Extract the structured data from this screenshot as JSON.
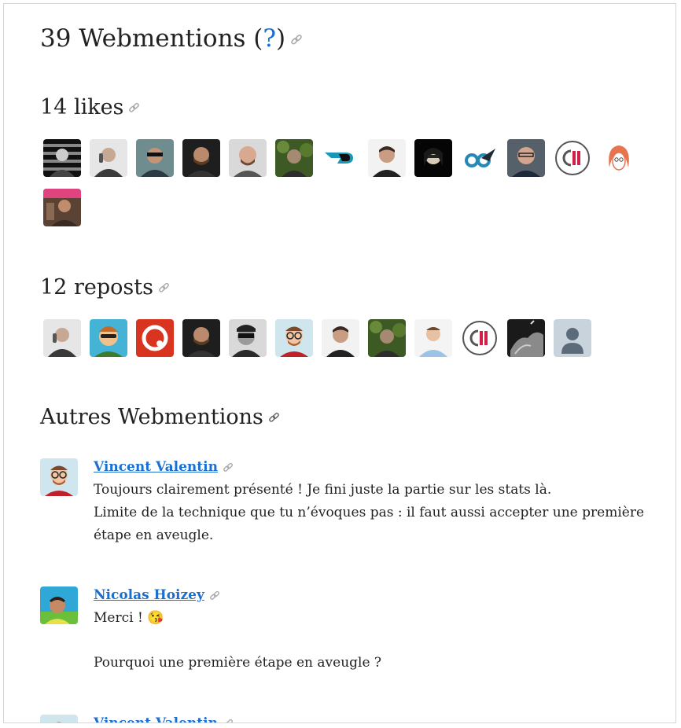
{
  "header": {
    "title_prefix": "39 Webmentions (",
    "help_glyph": "?",
    "title_suffix": ")"
  },
  "likes": {
    "heading": "14 likes",
    "faces": [
      "bw-stripes",
      "man-phone",
      "man-sunglasses",
      "man-beard-dark",
      "man-bald",
      "man-forest",
      "logo-blue-shape",
      "man-portrait",
      "woman-dark",
      "logo-blue-rocket",
      "man-glasses",
      "logo-c11",
      "drawing-redhead",
      "man-pink"
    ]
  },
  "reposts": {
    "heading": "12 reposts",
    "faces": [
      "man-phone",
      "cartoon-avatar",
      "logo-red",
      "man-beard-dark",
      "man-sunglasses-bw",
      "cartoon-vincent",
      "man-portrait",
      "man-forest",
      "man-shirt",
      "logo-c11",
      "hands-bw",
      "default-avatar"
    ]
  },
  "others": {
    "heading": "Autres Webmentions",
    "mentions": [
      {
        "author": "Vincent Valentin",
        "lines": [
          "Toujours clairement présenté ! Je fini juste la partie sur les stats là.",
          "Limite de la technique que tu n’évoques pas : il faut aussi accepter une première étape en aveugle."
        ]
      },
      {
        "author": "Nicolas Hoizey",
        "line1": "Merci ! 😘",
        "line2": "Pourquoi une première étape en aveugle ?"
      },
      {
        "author": "Vincent Valentin"
      }
    ]
  },
  "colors": {
    "link": "#1a6fd1",
    "text": "#222222",
    "permalink_icon": "#aaaaaa"
  }
}
